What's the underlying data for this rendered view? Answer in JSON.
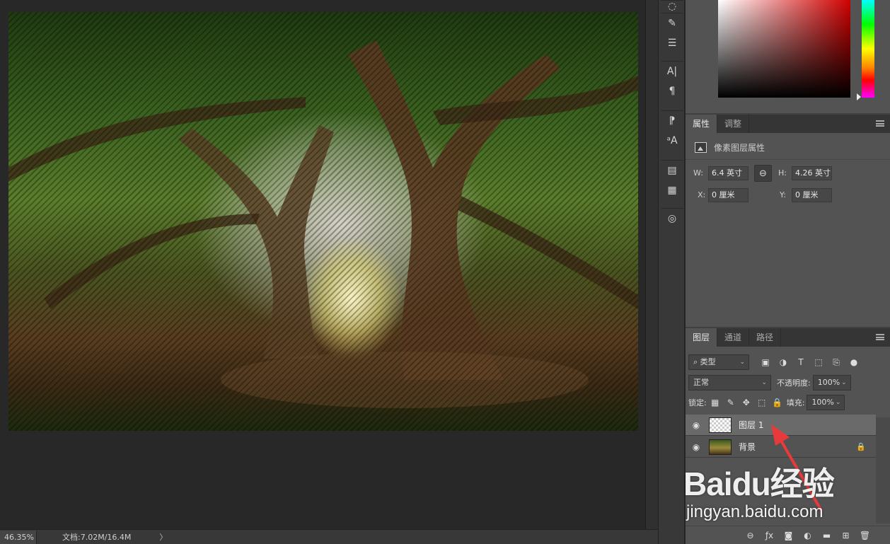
{
  "canvas": {
    "image_alt": "tree photo with marching-ants selection"
  },
  "status_bar": {
    "zoom": "46.35%",
    "doc_info": "文档:7.02M/16.4M",
    "arrow": "〉"
  },
  "tool_strip": {
    "tools": [
      "history-brush-tool",
      "adjustments-tool",
      "character-tool",
      "paragraph-tool",
      "paragraph-style-tool",
      "character-style-tool",
      "notes-tool",
      "info-tool",
      "3d-tool"
    ]
  },
  "properties": {
    "tabs": [
      {
        "label": "属性",
        "active": true
      },
      {
        "label": "调整",
        "active": false
      }
    ],
    "header": "像素图层属性",
    "w_label": "W:",
    "w_value": "6.4 英寸",
    "h_label": "H:",
    "h_value": "4.26 英寸",
    "x_label": "X:",
    "x_value": "0 厘米",
    "y_label": "Y:",
    "y_value": "0 厘米"
  },
  "layers": {
    "tabs": [
      {
        "label": "图层",
        "active": true
      },
      {
        "label": "通道",
        "active": false
      },
      {
        "label": "路径",
        "active": false
      }
    ],
    "filter_label": "类型",
    "blend_mode": "正常",
    "opacity_label": "不透明度:",
    "opacity_value": "100%",
    "lock_label": "锁定:",
    "fill_label": "填充:",
    "fill_value": "100%",
    "items": [
      {
        "name": "图层 1",
        "selected": true
      },
      {
        "name": "背景",
        "selected": false,
        "locked": true
      }
    ]
  },
  "watermark": {
    "brand": "Baidu经验",
    "domain": "jingyan.baidu.com"
  },
  "colors": {
    "panel_bg": "#535353",
    "tab_bg": "#353535",
    "canvas_bg": "#282828",
    "arrow_red": "#e83a3a"
  }
}
